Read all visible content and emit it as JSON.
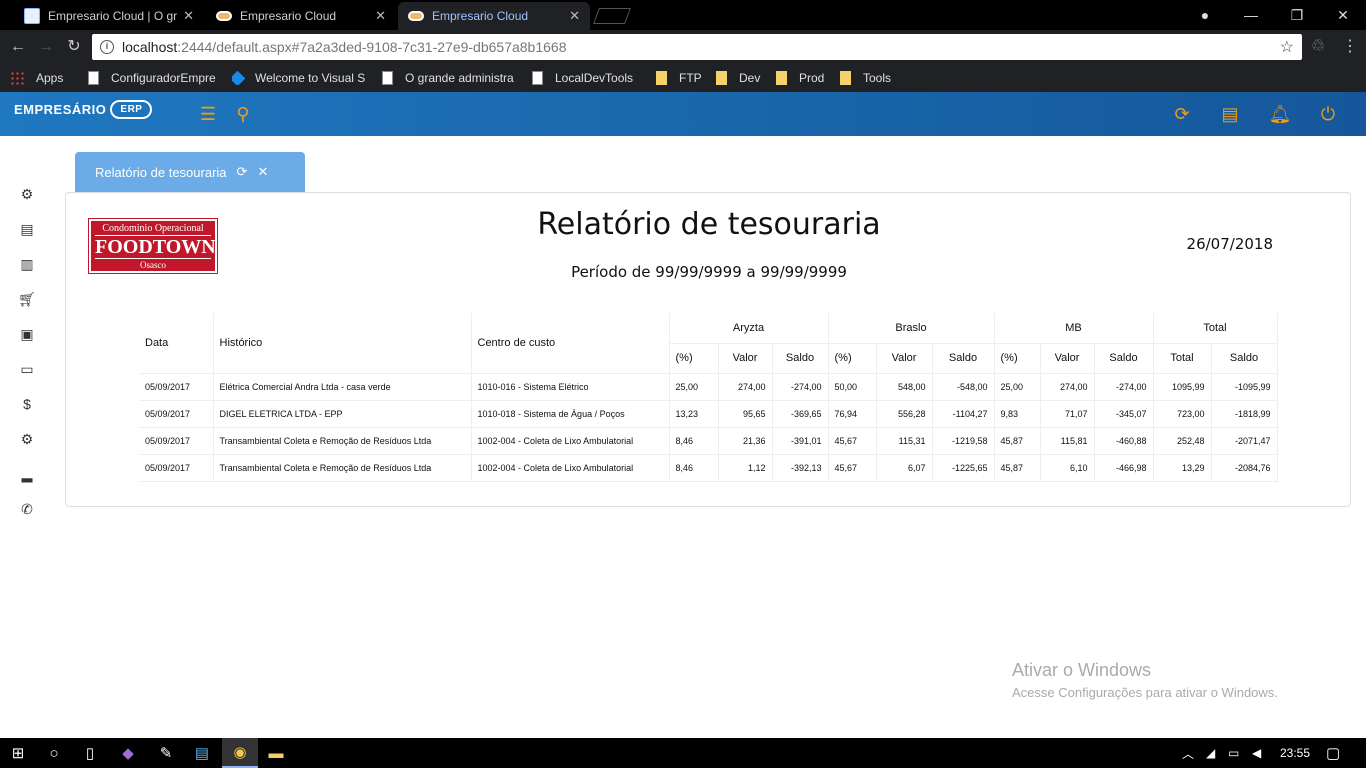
{
  "browser": {
    "tabs": [
      {
        "label": "Empresario Cloud | O gra",
        "icon": "document-icon",
        "active": false
      },
      {
        "label": "Empresario Cloud",
        "icon": "cloud-icon",
        "active": false
      },
      {
        "label": "Empresario Cloud",
        "icon": "cloud-icon",
        "active": true
      }
    ],
    "url_host": "localhost",
    "url_path": ":2444/default.aspx#7a2a3ded-9108-7c31-27e9-db657a8b1668",
    "bookmarks": [
      {
        "label": "Apps",
        "icon": "apps-grid-icon"
      },
      {
        "label": "ConfiguradorEmpre",
        "icon": "page-icon"
      },
      {
        "label": "Welcome to Visual S",
        "icon": "visual-studio-icon"
      },
      {
        "label": "O grande administra",
        "icon": "page-icon"
      },
      {
        "label": "LocalDevTools",
        "icon": "page-icon"
      },
      {
        "label": "FTP",
        "icon": "folder-icon"
      },
      {
        "label": "Dev",
        "icon": "folder-icon"
      },
      {
        "label": "Prod",
        "icon": "folder-icon"
      },
      {
        "label": "Tools",
        "icon": "folder-icon"
      }
    ]
  },
  "app": {
    "logo_text": "EMPRESÁRIO",
    "logo_badge": "ERP",
    "tab_label": "Relatório de tesouraria"
  },
  "report": {
    "company_line1": "Condominio Operacional",
    "company_line2": "FOODTOWN",
    "company_line3": "Osasco",
    "title": "Relatório de tesouraria",
    "period": "Período de 99/99/9999 a 99/99/9999",
    "date": "26/07/2018",
    "headers": {
      "data": "Data",
      "historico": "Histórico",
      "centro": "Centro de custo",
      "groups": [
        "Aryzta",
        "Braslo",
        "MB",
        "Total"
      ],
      "sub_pct": "(%)",
      "sub_valor": "Valor",
      "sub_saldo": "Saldo",
      "sub_total": "Total"
    },
    "rows": [
      [
        "05/09/2017",
        "Elétrica Comercial Andra Ltda - casa verde",
        "1010-016 - Sistema Elétrico",
        "25,00",
        "274,00",
        "-274,00",
        "50,00",
        "548,00",
        "-548,00",
        "25,00",
        "274,00",
        "-274,00",
        "1095,99",
        "-1095,99"
      ],
      [
        "05/09/2017",
        "DIGEL ELETRICA LTDA - EPP",
        "1010-018 - Sistema de Água / Poços",
        "13,23",
        "95,65",
        "-369,65",
        "76,94",
        "556,28",
        "-1104,27",
        "9,83",
        "71,07",
        "-345,07",
        "723,00",
        "-1818,99"
      ],
      [
        "05/09/2017",
        "Transambiental Coleta e Remoção de Resíduos Ltda",
        "1002-004 - Coleta de Lixo Ambulatorial",
        "8,46",
        "21,36",
        "-391,01",
        "45,67",
        "115,31",
        "-1219,58",
        "45,87",
        "115,81",
        "-460,88",
        "252,48",
        "-2071,47"
      ],
      [
        "05/09/2017",
        "Transambiental Coleta e Remoção de Resíduos Ltda",
        "1002-004 - Coleta de Lixo Ambulatorial",
        "8,46",
        "1,12",
        "-392,13",
        "45,67",
        "6,07",
        "-1225,65",
        "45,87",
        "6,10",
        "-466,98",
        "13,29",
        "-2084,76"
      ]
    ]
  },
  "watermark": {
    "line1": "Ativar o Windows",
    "line2": "Acesse Configurações para ativar o Windows."
  },
  "taskbar": {
    "clock": "23:55"
  }
}
